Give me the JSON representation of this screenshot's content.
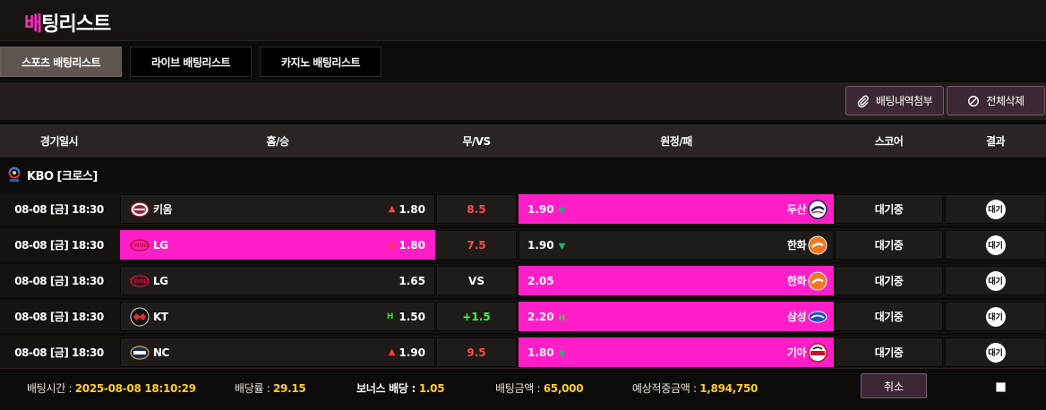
{
  "page": {
    "title_accent": "배",
    "title_rest": "팅리스트"
  },
  "tabs": [
    {
      "label": "스포츠 배팅리스트",
      "active": true
    },
    {
      "label": "라이브 배팅리스트",
      "active": false
    },
    {
      "label": "카지노 배팅리스트",
      "active": false
    }
  ],
  "actions": {
    "attach_label": "배팅내역첨부",
    "delete_label": "전체삭제"
  },
  "table": {
    "headers": [
      "경기일시",
      "홈/승",
      "무/VS",
      "원정/패",
      "스코어",
      "결과"
    ]
  },
  "league": {
    "name": "KBO [크로스]"
  },
  "games": [
    {
      "datetime": "08-08 [금] 18:30",
      "home": {
        "name": "키움",
        "odds": "1.80",
        "selected": false,
        "marker": "up",
        "logo": "kiwoom-logo"
      },
      "draw": {
        "value": "8.5",
        "style": "red"
      },
      "away": {
        "name": "두산",
        "odds": "1.90",
        "selected": true,
        "marker": "down",
        "logo": "doosan-logo"
      },
      "score": "대기중",
      "result": "대기"
    },
    {
      "datetime": "08-08 [금] 18:30",
      "home": {
        "name": "LG",
        "odds": "1.80",
        "selected": true,
        "marker": "up",
        "logo": "lg-logo"
      },
      "draw": {
        "value": "7.5",
        "style": "red"
      },
      "away": {
        "name": "한화",
        "odds": "1.90",
        "selected": false,
        "marker": "down",
        "logo": "hanwha-logo"
      },
      "score": "대기중",
      "result": "대기"
    },
    {
      "datetime": "08-08 [금] 18:30",
      "home": {
        "name": "LG",
        "odds": "1.65",
        "selected": false,
        "marker": "none",
        "logo": "lg-logo"
      },
      "draw": {
        "value": "VS",
        "style": "white"
      },
      "away": {
        "name": "한화",
        "odds": "2.05",
        "selected": true,
        "marker": "none",
        "logo": "hanwha-logo"
      },
      "score": "대기중",
      "result": "대기"
    },
    {
      "datetime": "08-08 [금] 18:30",
      "home": {
        "name": "KT",
        "odds": "1.50",
        "selected": false,
        "marker": "handicap",
        "logo": "kt-logo"
      },
      "draw": {
        "value": "+1.5",
        "style": "green"
      },
      "away": {
        "name": "삼성",
        "odds": "2.20",
        "selected": true,
        "marker": "handicap",
        "logo": "samsung-logo"
      },
      "score": "대기중",
      "result": "대기"
    },
    {
      "datetime": "08-08 [금] 18:30",
      "home": {
        "name": "NC",
        "odds": "1.90",
        "selected": false,
        "marker": "up",
        "logo": "nc-logo"
      },
      "draw": {
        "value": "9.5",
        "style": "red"
      },
      "away": {
        "name": "기아",
        "odds": "1.80",
        "selected": true,
        "marker": "down",
        "logo": "kia-logo"
      },
      "score": "대기중",
      "result": "대기"
    }
  ],
  "footer": {
    "bet_time_label": "배팅시간 : ",
    "bet_time": "2025-08-08 18:10:29",
    "odds_label": "배당률 : ",
    "odds": "29.15",
    "bonus_label": "보너스 배당 : ",
    "bonus": "1.05",
    "amount_label": "배팅금액 : ",
    "amount": "65,000",
    "expected_label": "예상적중금액 : ",
    "expected": "1,894,750",
    "cancel_label": "취소"
  },
  "colors": {
    "accent": "#ff2bc2",
    "selected_cell": "#ff1ec7",
    "value_yellow": "#ffcf24"
  }
}
